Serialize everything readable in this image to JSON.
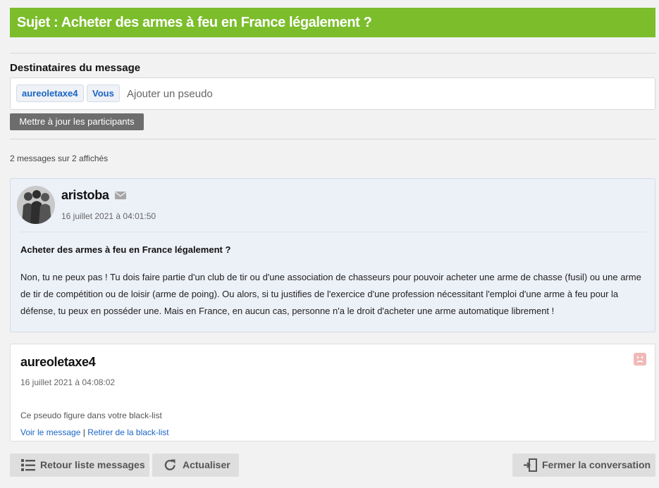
{
  "subject": {
    "title": "Sujet : Acheter des armes à feu en France légalement ?"
  },
  "recipients": {
    "heading": "Destinataires du message",
    "chips": [
      "aureoletaxe4",
      "Vous"
    ],
    "input_placeholder": "Ajouter un pseudo",
    "update_button": "Mettre à jour les participants"
  },
  "messages_count": "2 messages sur 2 affichés",
  "message1": {
    "author": "aristoba",
    "date": "16 juillet 2021 à 04:01:50",
    "title": "Acheter des armes à feu en France légalement ?",
    "body": "Non, tu ne peux pas ! Tu dois faire partie d'un club de tir ou d'une association de chasseurs pour pouvoir acheter une arme de chasse (fusil) ou une arme de tir de compétition ou de loisir (arme de poing). Ou alors, si tu justifies de l'exercice d'une profession nécessitant l'emploi d'une arme à feu pour la défense, tu peux en posséder une. Mais en France, en aucun cas, personne n'a le droit d'acheter une arme automatique librement !"
  },
  "message2": {
    "author": "aureoletaxe4",
    "date": "16 juillet 2021 à 04:08:02",
    "blacklist_note": "Ce pseudo figure dans votre black-list",
    "view_link": "Voir le message",
    "separator": "|",
    "remove_link": "Retirer de la black-list"
  },
  "actions": {
    "back": "Retour liste messages",
    "refresh": "Actualiser",
    "close": "Fermer la conversation"
  },
  "colors": {
    "subject_bar": "#7bbd2b",
    "link": "#1b64c4",
    "update_button": "#6d6d6d",
    "message1_bg": "#ecf0f7"
  },
  "icons": {
    "mail": "mail-icon",
    "sad": "sad-face-icon",
    "list": "list-icon",
    "refresh": "refresh-icon",
    "exit": "exit-door-icon"
  }
}
